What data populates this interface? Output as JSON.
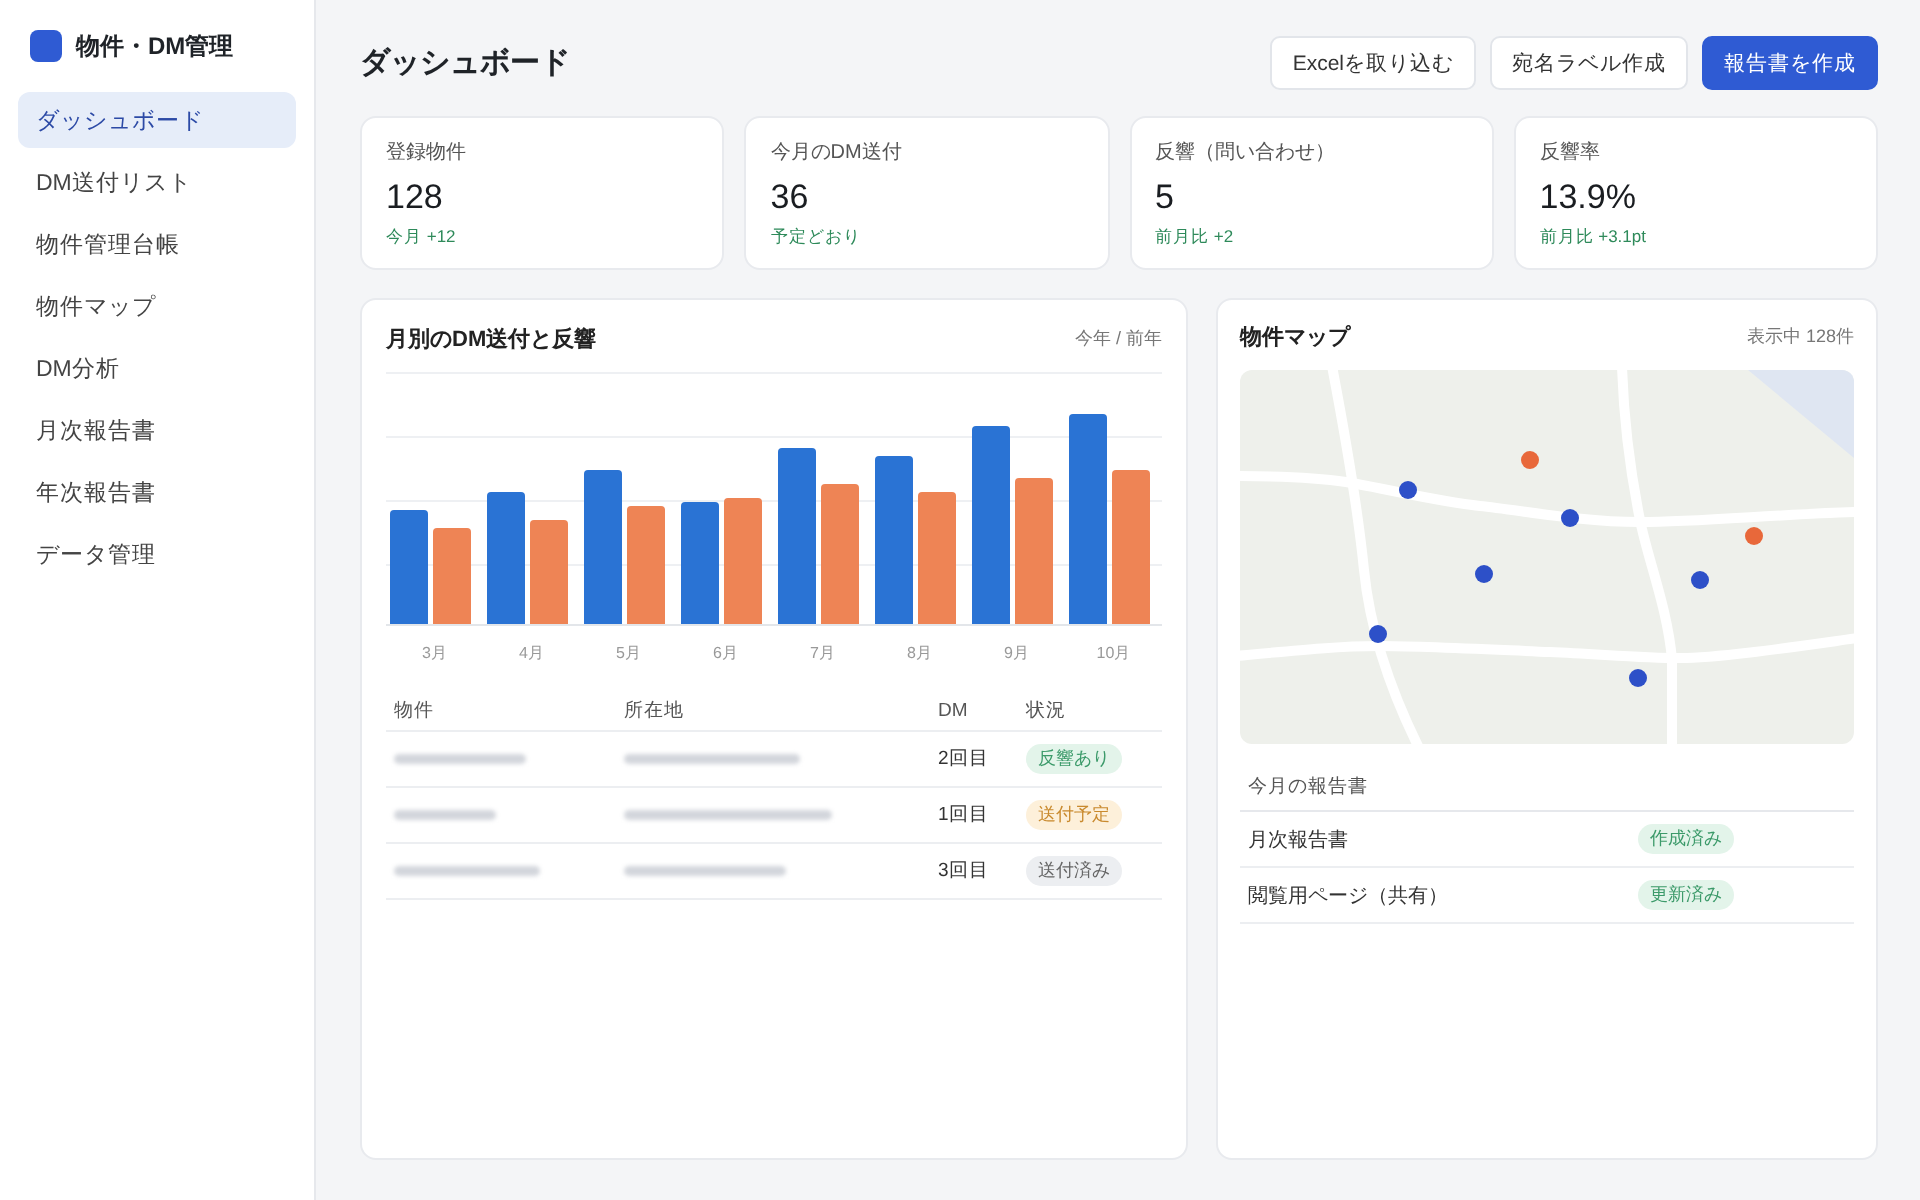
{
  "sidebar": {
    "app_title": "物件・DM管理",
    "items": [
      {
        "label": "ダッシュボード",
        "selected": true
      },
      {
        "label": "DM送付リスト",
        "selected": false
      },
      {
        "label": "物件管理台帳",
        "selected": false
      },
      {
        "label": "物件マップ",
        "selected": false
      },
      {
        "label": "DM分析",
        "selected": false
      },
      {
        "label": "月次報告書",
        "selected": false
      },
      {
        "label": "年次報告書",
        "selected": false
      },
      {
        "label": "データ管理",
        "selected": false
      }
    ]
  },
  "header": {
    "title": "ダッシュボード",
    "buttons": [
      {
        "label": "Excelを取り込む",
        "kind": "secondary"
      },
      {
        "label": "宛名ラベル作成",
        "kind": "secondary"
      },
      {
        "label": "報告書を作成",
        "kind": "primary"
      }
    ]
  },
  "stats": [
    {
      "label": "登録物件",
      "value": "128",
      "delta": "今月 +12"
    },
    {
      "label": "今月のDM送付",
      "value": "36",
      "delta": "予定どおり"
    },
    {
      "label": "反響（問い合わせ）",
      "value": "5",
      "delta": "前月比 +2"
    },
    {
      "label": "反響率",
      "value": "13.9%",
      "delta": "前月比 +3.1pt"
    }
  ],
  "chart_panel": {
    "title": "月別のDM送付と反響",
    "legend": "今年 / 前年",
    "months": [
      "3月",
      "4月",
      "5月",
      "6月",
      "7月",
      "8月",
      "9月",
      "10月"
    ],
    "table": {
      "columns": [
        "物件",
        "所在地",
        "DM",
        "状況"
      ],
      "rows": [
        {
          "dm": "2回目",
          "status": {
            "label": "反響あり",
            "kind": "positive"
          }
        },
        {
          "dm": "1回目",
          "status": {
            "label": "送付予定",
            "kind": "pending"
          }
        },
        {
          "dm": "3回目",
          "status": {
            "label": "送付済み",
            "kind": "neutral"
          }
        }
      ]
    }
  },
  "map_panel": {
    "title": "物件マップ",
    "count": "表示中 128件",
    "markers": [
      {
        "color": "#e8683a"
      },
      {
        "color": "#2d50c8"
      },
      {
        "color": "#2d50c8"
      },
      {
        "color": "#e8683a"
      },
      {
        "color": "#2d50c8"
      },
      {
        "color": "#2d50c8"
      },
      {
        "color": "#2d50c8"
      },
      {
        "color": "#2d50c8"
      }
    ],
    "reports": {
      "title": "今月の報告書",
      "rows": [
        {
          "name": "月次報告書",
          "status": {
            "label": "作成済み",
            "kind": "positive"
          }
        },
        {
          "name": "閲覧用ページ（共有）",
          "status": {
            "label": "更新済み",
            "kind": "positive"
          }
        }
      ]
    }
  }
}
